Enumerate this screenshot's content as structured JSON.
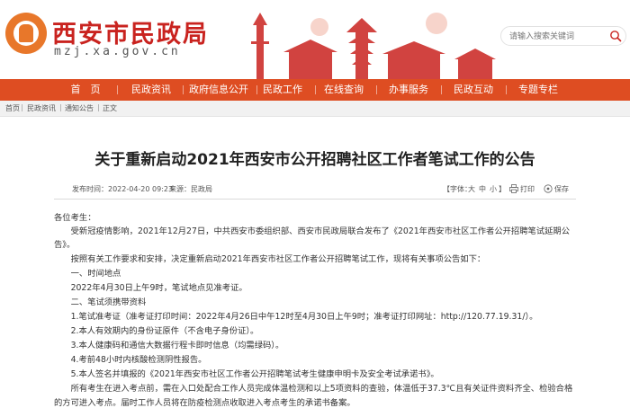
{
  "header": {
    "site_title": "西安市民政局",
    "site_domain": "mzj.xa.gov.cn",
    "search_placeholder": "请输入搜索关键词"
  },
  "nav": {
    "items": [
      "首　页",
      "民政资讯",
      "政府信息公开",
      "民政工作",
      "在线查询",
      "办事服务",
      "民政互动",
      "专题专栏"
    ]
  },
  "breadcrumb": {
    "items": [
      "首页",
      "民政资讯",
      "通知公告",
      "正文"
    ],
    "separator": "|"
  },
  "article": {
    "title": "关于重新启动2021年西安市公开招聘社区工作者笔试工作的公告",
    "publish_time": "发布时间：2022-04-20 09:23",
    "source": "来源：民政局",
    "font_size_label": "【字体：",
    "font_large": "大",
    "font_medium": "中",
    "font_small": "小",
    "font_size_close": "】",
    "print_label": "打印",
    "save_label": "保存",
    "paragraphs": [
      "各位考生：",
      "　　受新冠疫情影响，2021年12月27日，中共西安市委组织部、西安市民政局联合发布了《2021年西安市社区工作者公开招聘笔试延期公",
      "告》。",
      "　　按照有关工作要求和安排，决定重新启动2021年西安市社区工作者公开招聘笔试工作，现将有关事项公告如下：",
      "　　一、时间地点",
      "　　2022年4月30日上午9时，笔试地点见准考证。",
      "　　二、笔试须携带资料",
      "　　1.笔试准考证（准考证打印时间：2022年4月26日中午12时至4月30日上午9时；准考证打印网址：http://120.77.19.31/）。",
      "　　2.本人有效期内的身份证原件（不含电子身份证）。",
      "　　3.本人健康码和通信大数据行程卡即时信息（均需绿码）。",
      "　　4.考前48小时内核酸检测阴性报告。",
      "　　5.本人签名并填报的《2021年西安市社区工作者公开招聘笔试考生健康申明卡及安全考试承诺书》。",
      "　　所有考生在进入考点前，需在入口处配合工作人员完成体温检测和以上5项资料的查验，体温低于37.3℃且有关证件资料齐全、检验合格",
      "的方可进入考点。届时工作人员将在防疫检测点收取进入考点考生的承诺书备案。"
    ]
  },
  "colors": {
    "brand_red": "#c9231f",
    "nav_orange": "#de4d22",
    "logo_orange": "#e8772a"
  },
  "icons": [
    "search-icon",
    "print-icon",
    "save-icon",
    "logo-emblem-icon"
  ]
}
